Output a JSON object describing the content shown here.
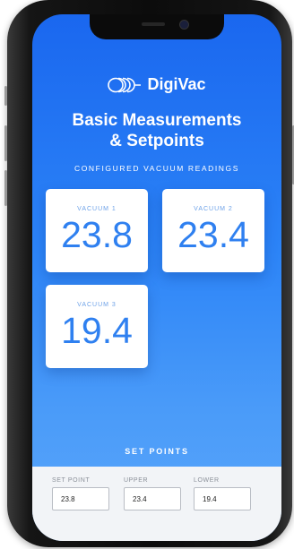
{
  "brand": {
    "name": "DigiVac"
  },
  "header": {
    "title_line1": "Basic Measurements",
    "title_line2": "& Setpoints"
  },
  "readings": {
    "section_title": "CONFIGURED VACUUM READINGS",
    "items": [
      {
        "label": "VACUUM 1",
        "value": "23.8"
      },
      {
        "label": "VACUUM 2",
        "value": "23.4"
      },
      {
        "label": "VACUUM 3",
        "value": "19.4"
      }
    ]
  },
  "setpoints": {
    "section_title": "SET POINTS",
    "fields": [
      {
        "label": "SET POINT",
        "value": "23.8"
      },
      {
        "label": "UPPER",
        "value": "23.4"
      },
      {
        "label": "LOWER",
        "value": "19.4"
      }
    ]
  },
  "colors": {
    "accent": "#2f80f0",
    "gradient_top": "#1a67ef",
    "gradient_bottom": "#5aa6fa"
  },
  "icons": [
    "digivac-logo-icon"
  ]
}
